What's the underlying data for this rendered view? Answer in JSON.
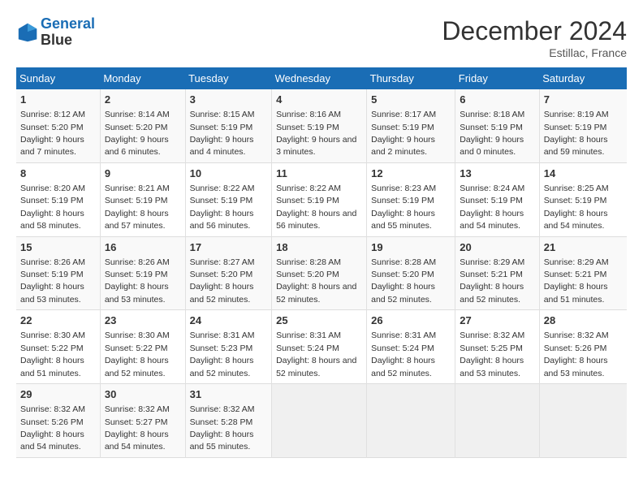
{
  "header": {
    "logo_line1": "General",
    "logo_line2": "Blue",
    "month": "December 2024",
    "location": "Estillac, France"
  },
  "days_of_week": [
    "Sunday",
    "Monday",
    "Tuesday",
    "Wednesday",
    "Thursday",
    "Friday",
    "Saturday"
  ],
  "weeks": [
    [
      {
        "day": 1,
        "sunrise": "Sunrise: 8:12 AM",
        "sunset": "Sunset: 5:20 PM",
        "daylight": "Daylight: 9 hours and 7 minutes."
      },
      {
        "day": 2,
        "sunrise": "Sunrise: 8:14 AM",
        "sunset": "Sunset: 5:20 PM",
        "daylight": "Daylight: 9 hours and 6 minutes."
      },
      {
        "day": 3,
        "sunrise": "Sunrise: 8:15 AM",
        "sunset": "Sunset: 5:19 PM",
        "daylight": "Daylight: 9 hours and 4 minutes."
      },
      {
        "day": 4,
        "sunrise": "Sunrise: 8:16 AM",
        "sunset": "Sunset: 5:19 PM",
        "daylight": "Daylight: 9 hours and 3 minutes."
      },
      {
        "day": 5,
        "sunrise": "Sunrise: 8:17 AM",
        "sunset": "Sunset: 5:19 PM",
        "daylight": "Daylight: 9 hours and 2 minutes."
      },
      {
        "day": 6,
        "sunrise": "Sunrise: 8:18 AM",
        "sunset": "Sunset: 5:19 PM",
        "daylight": "Daylight: 9 hours and 0 minutes."
      },
      {
        "day": 7,
        "sunrise": "Sunrise: 8:19 AM",
        "sunset": "Sunset: 5:19 PM",
        "daylight": "Daylight: 8 hours and 59 minutes."
      }
    ],
    [
      {
        "day": 8,
        "sunrise": "Sunrise: 8:20 AM",
        "sunset": "Sunset: 5:19 PM",
        "daylight": "Daylight: 8 hours and 58 minutes."
      },
      {
        "day": 9,
        "sunrise": "Sunrise: 8:21 AM",
        "sunset": "Sunset: 5:19 PM",
        "daylight": "Daylight: 8 hours and 57 minutes."
      },
      {
        "day": 10,
        "sunrise": "Sunrise: 8:22 AM",
        "sunset": "Sunset: 5:19 PM",
        "daylight": "Daylight: 8 hours and 56 minutes."
      },
      {
        "day": 11,
        "sunrise": "Sunrise: 8:22 AM",
        "sunset": "Sunset: 5:19 PM",
        "daylight": "Daylight: 8 hours and 56 minutes."
      },
      {
        "day": 12,
        "sunrise": "Sunrise: 8:23 AM",
        "sunset": "Sunset: 5:19 PM",
        "daylight": "Daylight: 8 hours and 55 minutes."
      },
      {
        "day": 13,
        "sunrise": "Sunrise: 8:24 AM",
        "sunset": "Sunset: 5:19 PM",
        "daylight": "Daylight: 8 hours and 54 minutes."
      },
      {
        "day": 14,
        "sunrise": "Sunrise: 8:25 AM",
        "sunset": "Sunset: 5:19 PM",
        "daylight": "Daylight: 8 hours and 54 minutes."
      }
    ],
    [
      {
        "day": 15,
        "sunrise": "Sunrise: 8:26 AM",
        "sunset": "Sunset: 5:19 PM",
        "daylight": "Daylight: 8 hours and 53 minutes."
      },
      {
        "day": 16,
        "sunrise": "Sunrise: 8:26 AM",
        "sunset": "Sunset: 5:19 PM",
        "daylight": "Daylight: 8 hours and 53 minutes."
      },
      {
        "day": 17,
        "sunrise": "Sunrise: 8:27 AM",
        "sunset": "Sunset: 5:20 PM",
        "daylight": "Daylight: 8 hours and 52 minutes."
      },
      {
        "day": 18,
        "sunrise": "Sunrise: 8:28 AM",
        "sunset": "Sunset: 5:20 PM",
        "daylight": "Daylight: 8 hours and 52 minutes."
      },
      {
        "day": 19,
        "sunrise": "Sunrise: 8:28 AM",
        "sunset": "Sunset: 5:20 PM",
        "daylight": "Daylight: 8 hours and 52 minutes."
      },
      {
        "day": 20,
        "sunrise": "Sunrise: 8:29 AM",
        "sunset": "Sunset: 5:21 PM",
        "daylight": "Daylight: 8 hours and 52 minutes."
      },
      {
        "day": 21,
        "sunrise": "Sunrise: 8:29 AM",
        "sunset": "Sunset: 5:21 PM",
        "daylight": "Daylight: 8 hours and 51 minutes."
      }
    ],
    [
      {
        "day": 22,
        "sunrise": "Sunrise: 8:30 AM",
        "sunset": "Sunset: 5:22 PM",
        "daylight": "Daylight: 8 hours and 51 minutes."
      },
      {
        "day": 23,
        "sunrise": "Sunrise: 8:30 AM",
        "sunset": "Sunset: 5:22 PM",
        "daylight": "Daylight: 8 hours and 52 minutes."
      },
      {
        "day": 24,
        "sunrise": "Sunrise: 8:31 AM",
        "sunset": "Sunset: 5:23 PM",
        "daylight": "Daylight: 8 hours and 52 minutes."
      },
      {
        "day": 25,
        "sunrise": "Sunrise: 8:31 AM",
        "sunset": "Sunset: 5:24 PM",
        "daylight": "Daylight: 8 hours and 52 minutes."
      },
      {
        "day": 26,
        "sunrise": "Sunrise: 8:31 AM",
        "sunset": "Sunset: 5:24 PM",
        "daylight": "Daylight: 8 hours and 52 minutes."
      },
      {
        "day": 27,
        "sunrise": "Sunrise: 8:32 AM",
        "sunset": "Sunset: 5:25 PM",
        "daylight": "Daylight: 8 hours and 53 minutes."
      },
      {
        "day": 28,
        "sunrise": "Sunrise: 8:32 AM",
        "sunset": "Sunset: 5:26 PM",
        "daylight": "Daylight: 8 hours and 53 minutes."
      }
    ],
    [
      {
        "day": 29,
        "sunrise": "Sunrise: 8:32 AM",
        "sunset": "Sunset: 5:26 PM",
        "daylight": "Daylight: 8 hours and 54 minutes."
      },
      {
        "day": 30,
        "sunrise": "Sunrise: 8:32 AM",
        "sunset": "Sunset: 5:27 PM",
        "daylight": "Daylight: 8 hours and 54 minutes."
      },
      {
        "day": 31,
        "sunrise": "Sunrise: 8:32 AM",
        "sunset": "Sunset: 5:28 PM",
        "daylight": "Daylight: 8 hours and 55 minutes."
      },
      null,
      null,
      null,
      null
    ]
  ]
}
